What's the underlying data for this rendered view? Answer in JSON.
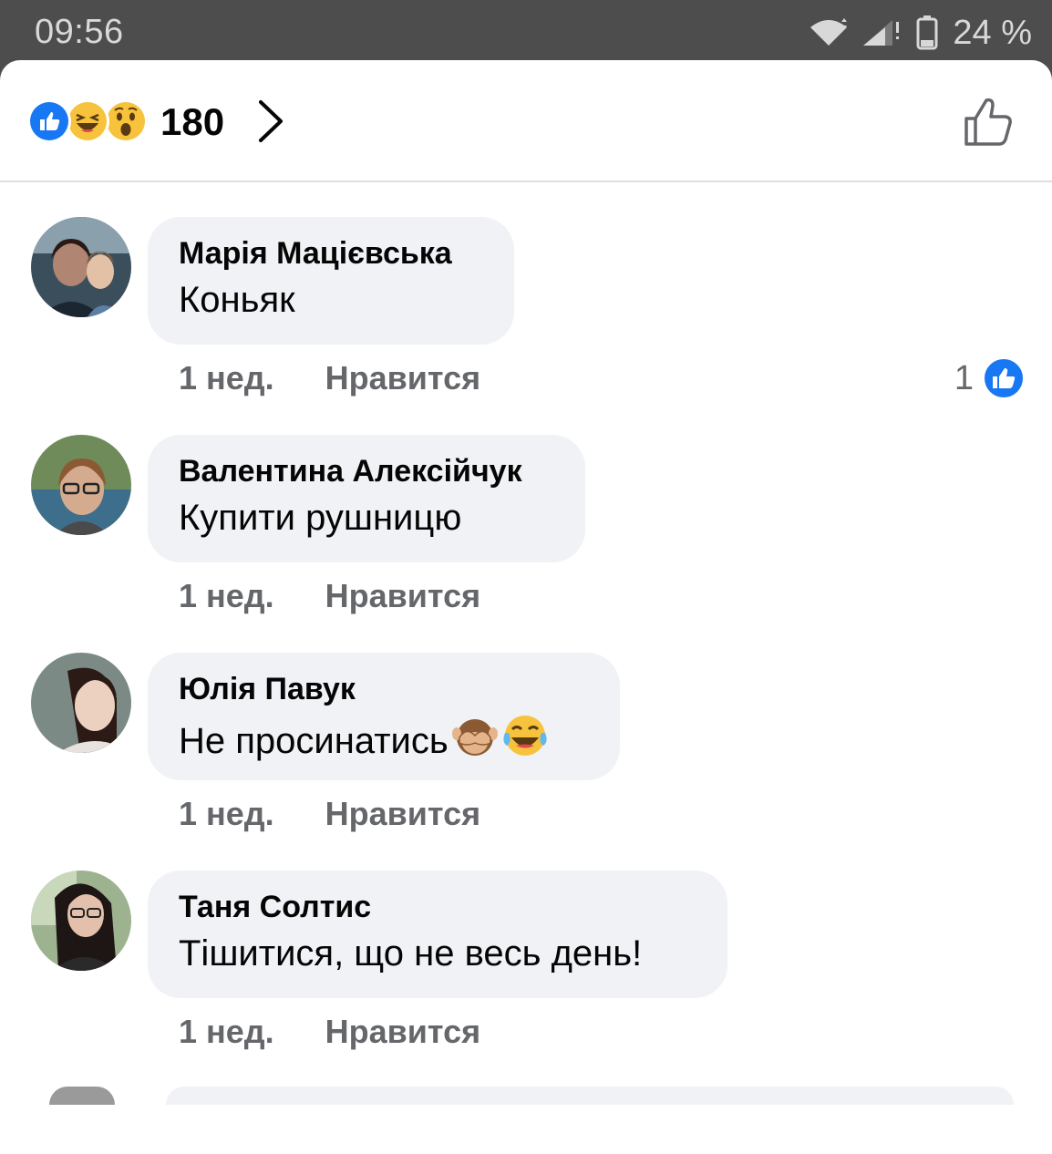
{
  "status_bar": {
    "time": "09:56",
    "battery": "24 %",
    "icons": [
      "wifi-icon",
      "signal-icon",
      "battery-icon"
    ]
  },
  "reactions": {
    "types": [
      "like",
      "haha",
      "wow"
    ],
    "count": "180",
    "colors": {
      "like": "#1877f2",
      "emoji_yellow": "#f7c23c"
    }
  },
  "comments": [
    {
      "author": "Марія Мацієвська",
      "text": "Коньяк",
      "time": "1 нед.",
      "like_label": "Нравится",
      "likes": "1"
    },
    {
      "author": "Валентина Алексійчук",
      "text": "Купити рушницю",
      "time": "1 нед.",
      "like_label": "Нравится"
    },
    {
      "author": "Юлія Павук",
      "text": "Не просинатись",
      "emojis": [
        "see-no-evil-monkey",
        "tears-of-joy"
      ],
      "time": "1 нед.",
      "like_label": "Нравится"
    },
    {
      "author": "Таня Солтис",
      "text": "Тішитися, що не весь день!",
      "time": "1 нед.",
      "like_label": "Нравится"
    }
  ],
  "colors": {
    "bubble_bg": "#f0f2f5",
    "meta_text": "#65676b",
    "status_bar_bg": "#4d4d4d"
  }
}
